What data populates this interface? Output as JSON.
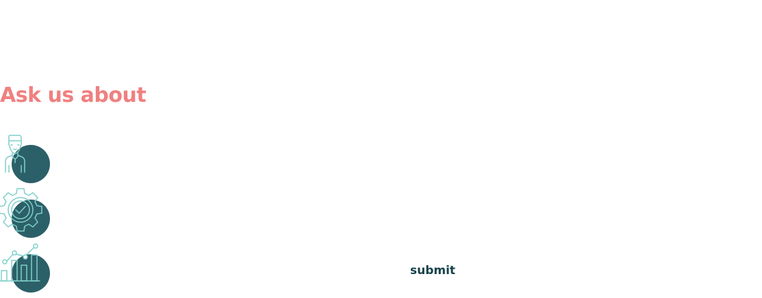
{
  "section": {
    "heading": "Ask us about"
  },
  "topics": [
    {
      "icon": "developer-person-icon"
    },
    {
      "icon": "gear-check-icon"
    },
    {
      "icon": "growth-chart-icon"
    }
  ],
  "form": {
    "submit_label": "submit"
  },
  "colors": {
    "heading": "#f08080",
    "disc": "#2c6069",
    "icon_stroke": "#7ecfca",
    "submit_text": "#16414a"
  }
}
